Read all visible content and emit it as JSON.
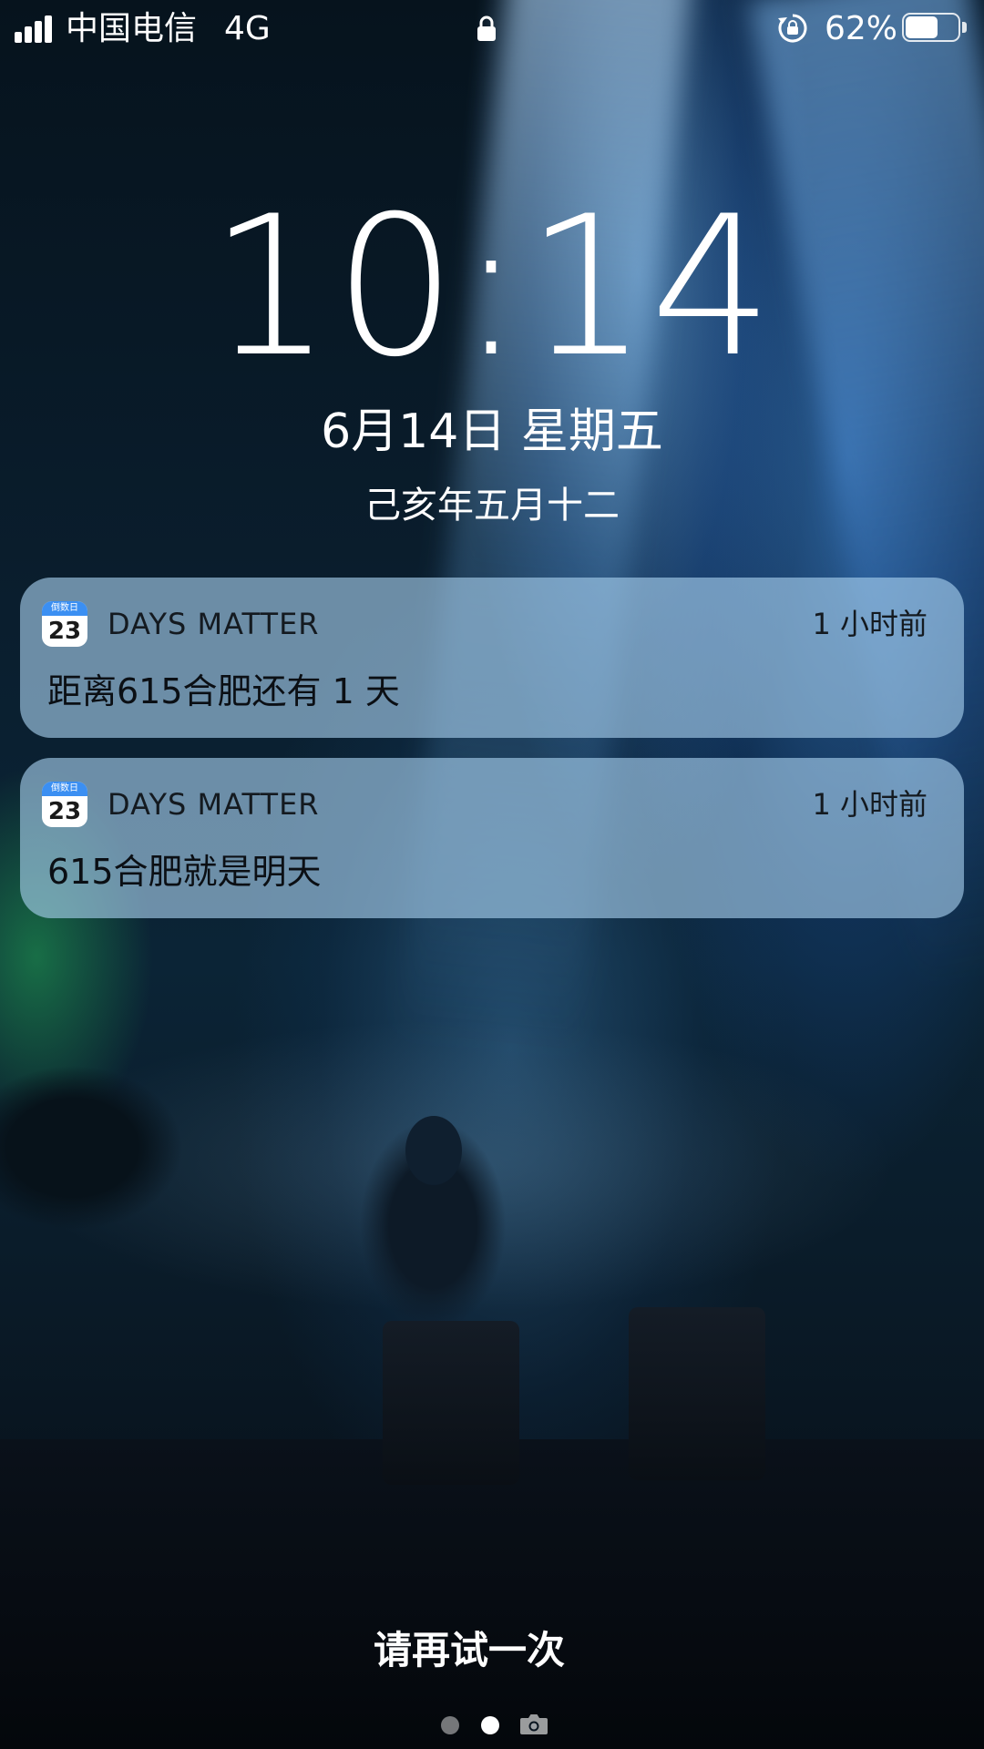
{
  "status_bar": {
    "carrier": "中国电信",
    "network": "4G",
    "battery_percent_label": "62%",
    "battery_level": 0.62,
    "icons": [
      "signal-icon",
      "lock-icon",
      "rotation-lock-icon",
      "battery-icon"
    ]
  },
  "lock_screen": {
    "time": "10:14",
    "date": "6月14日 星期五",
    "lunar_date": "己亥年五月十二"
  },
  "notifications": [
    {
      "app_name": "DAYS MATTER",
      "app_icon_caption": "倒数日",
      "app_icon_number": "23",
      "time": "1 小时前",
      "body": "距离615合肥还有 1 天"
    },
    {
      "app_name": "DAYS MATTER",
      "app_icon_caption": "倒数日",
      "app_icon_number": "23",
      "time": "1 小时前",
      "body": "615合肥就是明天"
    }
  ],
  "bottom": {
    "retry_text": "请再试一次",
    "page_indicator": {
      "pages": 2,
      "current": 2,
      "trailing_icon": "camera-icon"
    }
  },
  "colors": {
    "notification_background": "#AAD2F0",
    "text_light": "#FFFFFF",
    "text_dark": "#0B0F14",
    "app_icon_accent": "#3B8FF2"
  }
}
